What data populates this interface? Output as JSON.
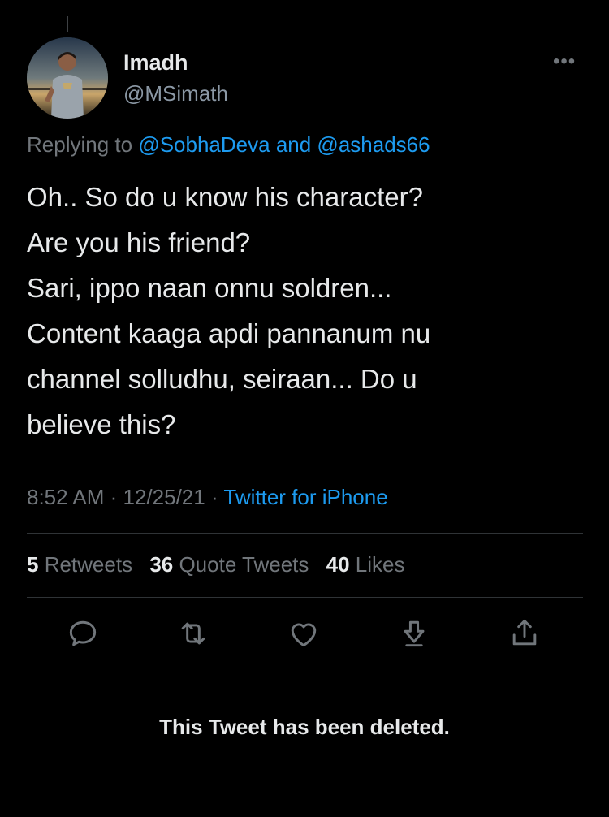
{
  "author": {
    "display_name": "Imadh",
    "handle": "@MSimath"
  },
  "more_label": "•••",
  "reply_context": {
    "prefix": "Replying to ",
    "mention1": "@SobhaDeva",
    "joiner": " and ",
    "mention2": "@ashads66"
  },
  "tweet": {
    "lines": [
      "Oh.. So do u know his character?",
      "Are you his friend?",
      "Sari, ippo naan onnu soldren...",
      "Content kaaga apdi pannanum nu",
      "channel solludhu, seiraan... Do u",
      "believe this?"
    ],
    "time": "8:52 AM",
    "date": "12/25/21",
    "source": "Twitter for iPhone",
    "sep": " · "
  },
  "stats": {
    "retweets_count": "5",
    "retweets_label": " Retweets",
    "quotes_count": "36",
    "quotes_label": " Quote Tweets",
    "likes_count": "40",
    "likes_label": " Likes"
  },
  "actions": [
    "reply-icon",
    "retweet-icon",
    "like-icon",
    "bookmark-icon",
    "share-icon"
  ],
  "deleted_notice": "This Tweet has been deleted.",
  "colors": {
    "background": "#000000",
    "text": "#e7e9ea",
    "muted": "#71767b",
    "link": "#1d9bf0",
    "divider": "#2f3336"
  }
}
